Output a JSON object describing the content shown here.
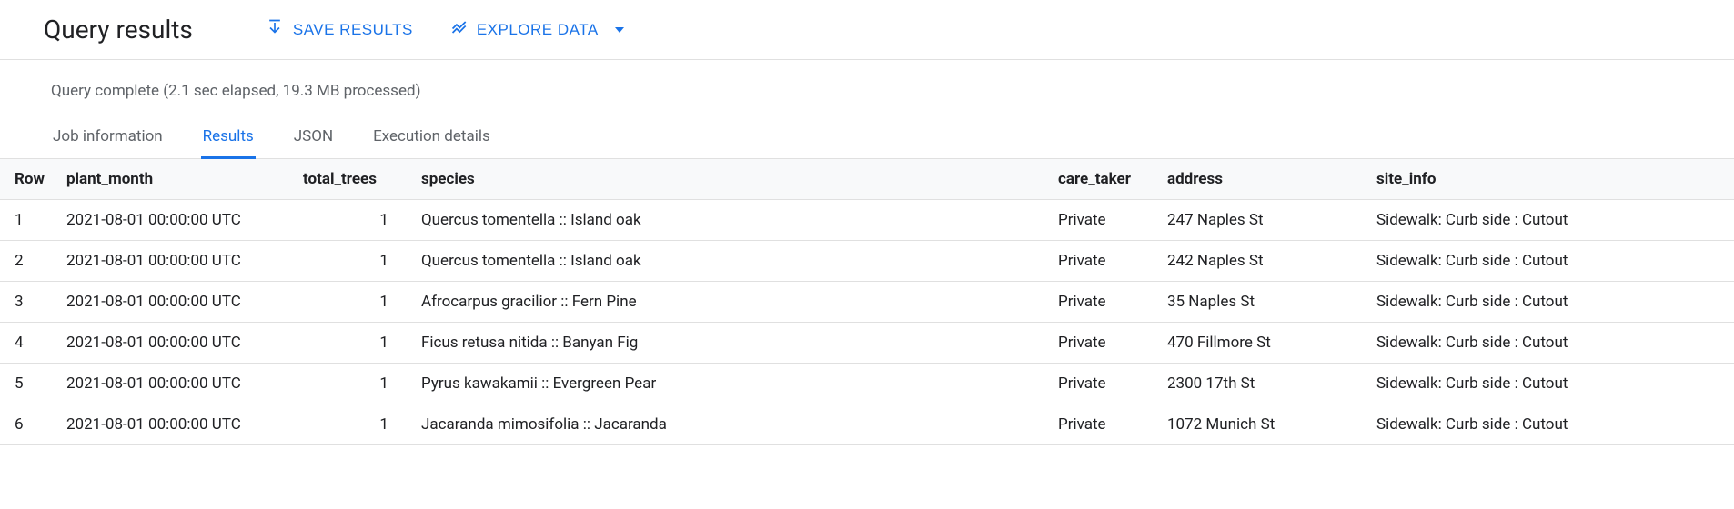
{
  "header": {
    "title": "Query results",
    "save_label": "SAVE RESULTS",
    "explore_label": "EXPLORE DATA"
  },
  "status": "Query complete (2.1 sec elapsed, 19.3 MB processed)",
  "tabs": [
    {
      "label": "Job information",
      "active": false
    },
    {
      "label": "Results",
      "active": true
    },
    {
      "label": "JSON",
      "active": false
    },
    {
      "label": "Execution details",
      "active": false
    }
  ],
  "columns": [
    "Row",
    "plant_month",
    "total_trees",
    "species",
    "care_taker",
    "address",
    "site_info"
  ],
  "rows": [
    {
      "row": "1",
      "plant_month": "2021-08-01 00:00:00 UTC",
      "total_trees": "1",
      "species": "Quercus tomentella :: Island oak",
      "care_taker": "Private",
      "address": "247 Naples St",
      "site_info": "Sidewalk: Curb side : Cutout"
    },
    {
      "row": "2",
      "plant_month": "2021-08-01 00:00:00 UTC",
      "total_trees": "1",
      "species": "Quercus tomentella :: Island oak",
      "care_taker": "Private",
      "address": "242 Naples St",
      "site_info": "Sidewalk: Curb side : Cutout"
    },
    {
      "row": "3",
      "plant_month": "2021-08-01 00:00:00 UTC",
      "total_trees": "1",
      "species": "Afrocarpus gracilior :: Fern Pine",
      "care_taker": "Private",
      "address": "35 Naples St",
      "site_info": "Sidewalk: Curb side : Cutout"
    },
    {
      "row": "4",
      "plant_month": "2021-08-01 00:00:00 UTC",
      "total_trees": "1",
      "species": "Ficus retusa nitida :: Banyan Fig",
      "care_taker": "Private",
      "address": "470 Fillmore St",
      "site_info": "Sidewalk: Curb side : Cutout"
    },
    {
      "row": "5",
      "plant_month": "2021-08-01 00:00:00 UTC",
      "total_trees": "1",
      "species": "Pyrus kawakamii :: Evergreen Pear",
      "care_taker": "Private",
      "address": "2300 17th St",
      "site_info": "Sidewalk: Curb side : Cutout"
    },
    {
      "row": "6",
      "plant_month": "2021-08-01 00:00:00 UTC",
      "total_trees": "1",
      "species": "Jacaranda mimosifolia :: Jacaranda",
      "care_taker": "Private",
      "address": "1072 Munich St",
      "site_info": "Sidewalk: Curb side : Cutout"
    }
  ]
}
